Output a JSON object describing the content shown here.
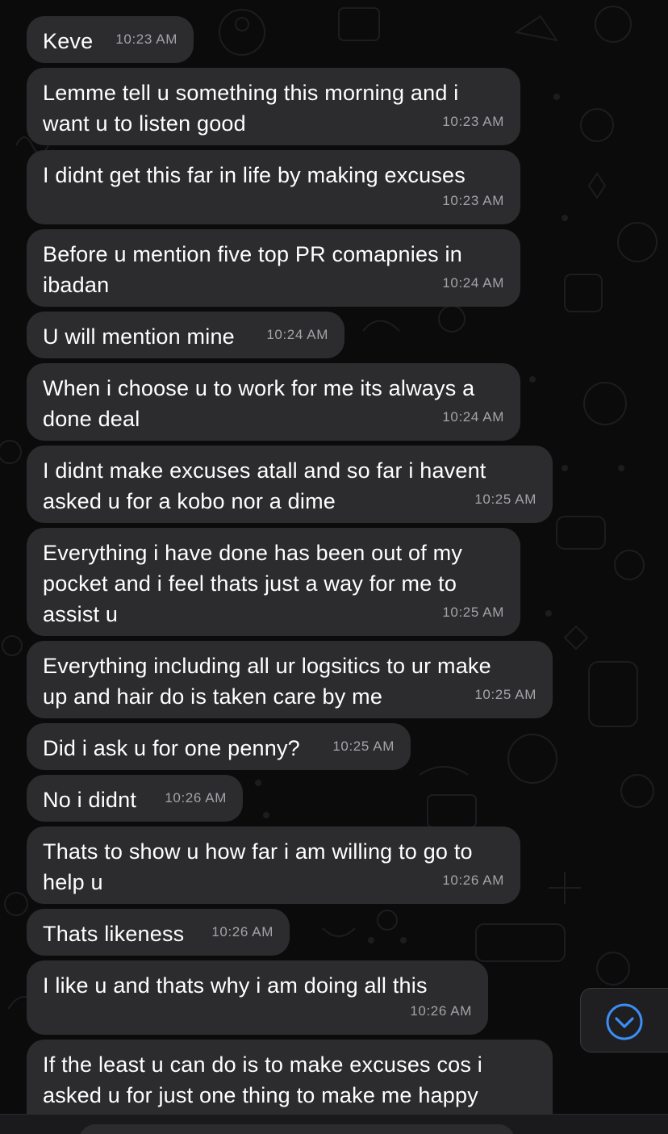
{
  "colors": {
    "background": "#0b0b0c",
    "bubble": "#2c2c2e",
    "message_text": "#ffffff",
    "timestamp": "#a3a3a8",
    "scroll_button_icon": "#3a8ef6"
  },
  "messages": [
    {
      "text": "Keve",
      "time": "10:23 AM"
    },
    {
      "text": "Lemme tell u something this morning and i\nwant u to listen good",
      "time": "10:23 AM"
    },
    {
      "text": "I didnt get this far in life by making excuses",
      "time": "10:23 AM"
    },
    {
      "text": "Before u mention five top PR comapnies in\nibadan",
      "time": "10:24 AM"
    },
    {
      "text": "U will mention mine",
      "time": "10:24 AM"
    },
    {
      "text": "When i choose u to work for me its always a\ndone deal",
      "time": "10:24 AM"
    },
    {
      "text": "I didnt make excuses atall and so far i havent\nasked u for a kobo nor a dime",
      "time": "10:25 AM"
    },
    {
      "text": "Everything i have done has been out of my\npocket and i feel thats just a way for me to\nassist u",
      "time": "10:25 AM"
    },
    {
      "text": "Everything including all ur logsitics to ur make\nup and hair do is taken care by me",
      "time": "10:25 AM"
    },
    {
      "text": "Did i ask u for one penny?",
      "time": "10:25 AM"
    },
    {
      "text": "No i didnt",
      "time": "10:26 AM"
    },
    {
      "text": "Thats to show u how far i am willing to go to\nhelp u",
      "time": "10:26 AM"
    },
    {
      "text": "Thats likeness",
      "time": "10:26 AM"
    },
    {
      "text": "I like u and thats why i am doing all this",
      "time": "10:26 AM"
    },
    {
      "text": "If the least u can do is to make excuses cos i\nasked u for just one thing to make me happy",
      "time": ""
    }
  ],
  "scroll_button": {
    "icon": "chevron-down-circle-icon"
  },
  "wallpaper": {
    "icon": "doodle-pattern"
  }
}
